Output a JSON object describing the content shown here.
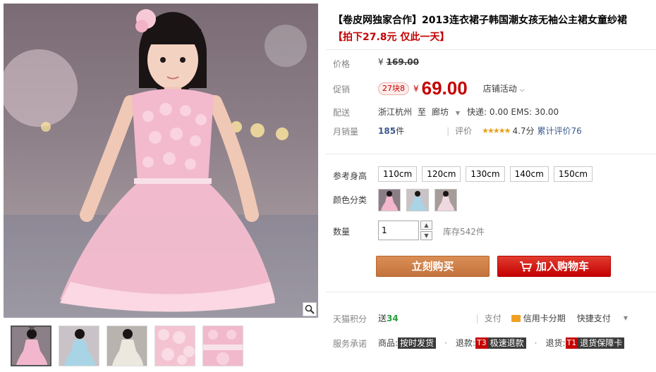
{
  "product": {
    "title": "【卷皮网独家合作】2013连衣裙子韩国潮女孩无袖公主裙女童纱裙",
    "subtitle": "【拍下27.8元 仅此一天】"
  },
  "price": {
    "label": "价格",
    "yen": "¥",
    "original": "169.00"
  },
  "promo": {
    "label": "促销",
    "badge": "27块8",
    "yen": "¥",
    "price": "69.00",
    "shop_activity": "店铺活动"
  },
  "delivery": {
    "label": "配送",
    "from": "浙江杭州",
    "to_word": "至",
    "to": "廊坊",
    "express": "快递: 0.00 EMS: 30.00"
  },
  "sales": {
    "label": "月销量",
    "count": "185",
    "unit": "件",
    "review_label": "评价",
    "stars": "★★★★★",
    "rating": "4.7分",
    "total_reviews": "累计评价76"
  },
  "size": {
    "label": "参考身高",
    "options": [
      "110cm",
      "120cm",
      "130cm",
      "140cm",
      "150cm"
    ]
  },
  "color": {
    "label": "颜色分类"
  },
  "quantity": {
    "label": "数量",
    "value": "1",
    "stock": "库存542件"
  },
  "actions": {
    "buy_now": "立刻购买",
    "add_to_cart": "加入购物车"
  },
  "points": {
    "label": "天猫积分",
    "send": "送",
    "amount": "34",
    "pay_label": "支付",
    "credit_card": "信用卡分期",
    "quick_pay": "快捷支付"
  },
  "service": {
    "label": "服务承诺",
    "goods_label": "商品:",
    "goods_tag": "按时发货",
    "refund_label": "退款:",
    "refund_code": "T3",
    "refund_tag": "极速退款",
    "return_label": "退货:",
    "return_code": "T1",
    "return_tag": "退货保障卡"
  },
  "colors": {
    "accent": "#c40000",
    "buy_btn": "#c4733d",
    "dress_pink": "#f2b7cc",
    "dress_blue": "#a9d4e6",
    "dress_white": "#e8e4dc"
  }
}
